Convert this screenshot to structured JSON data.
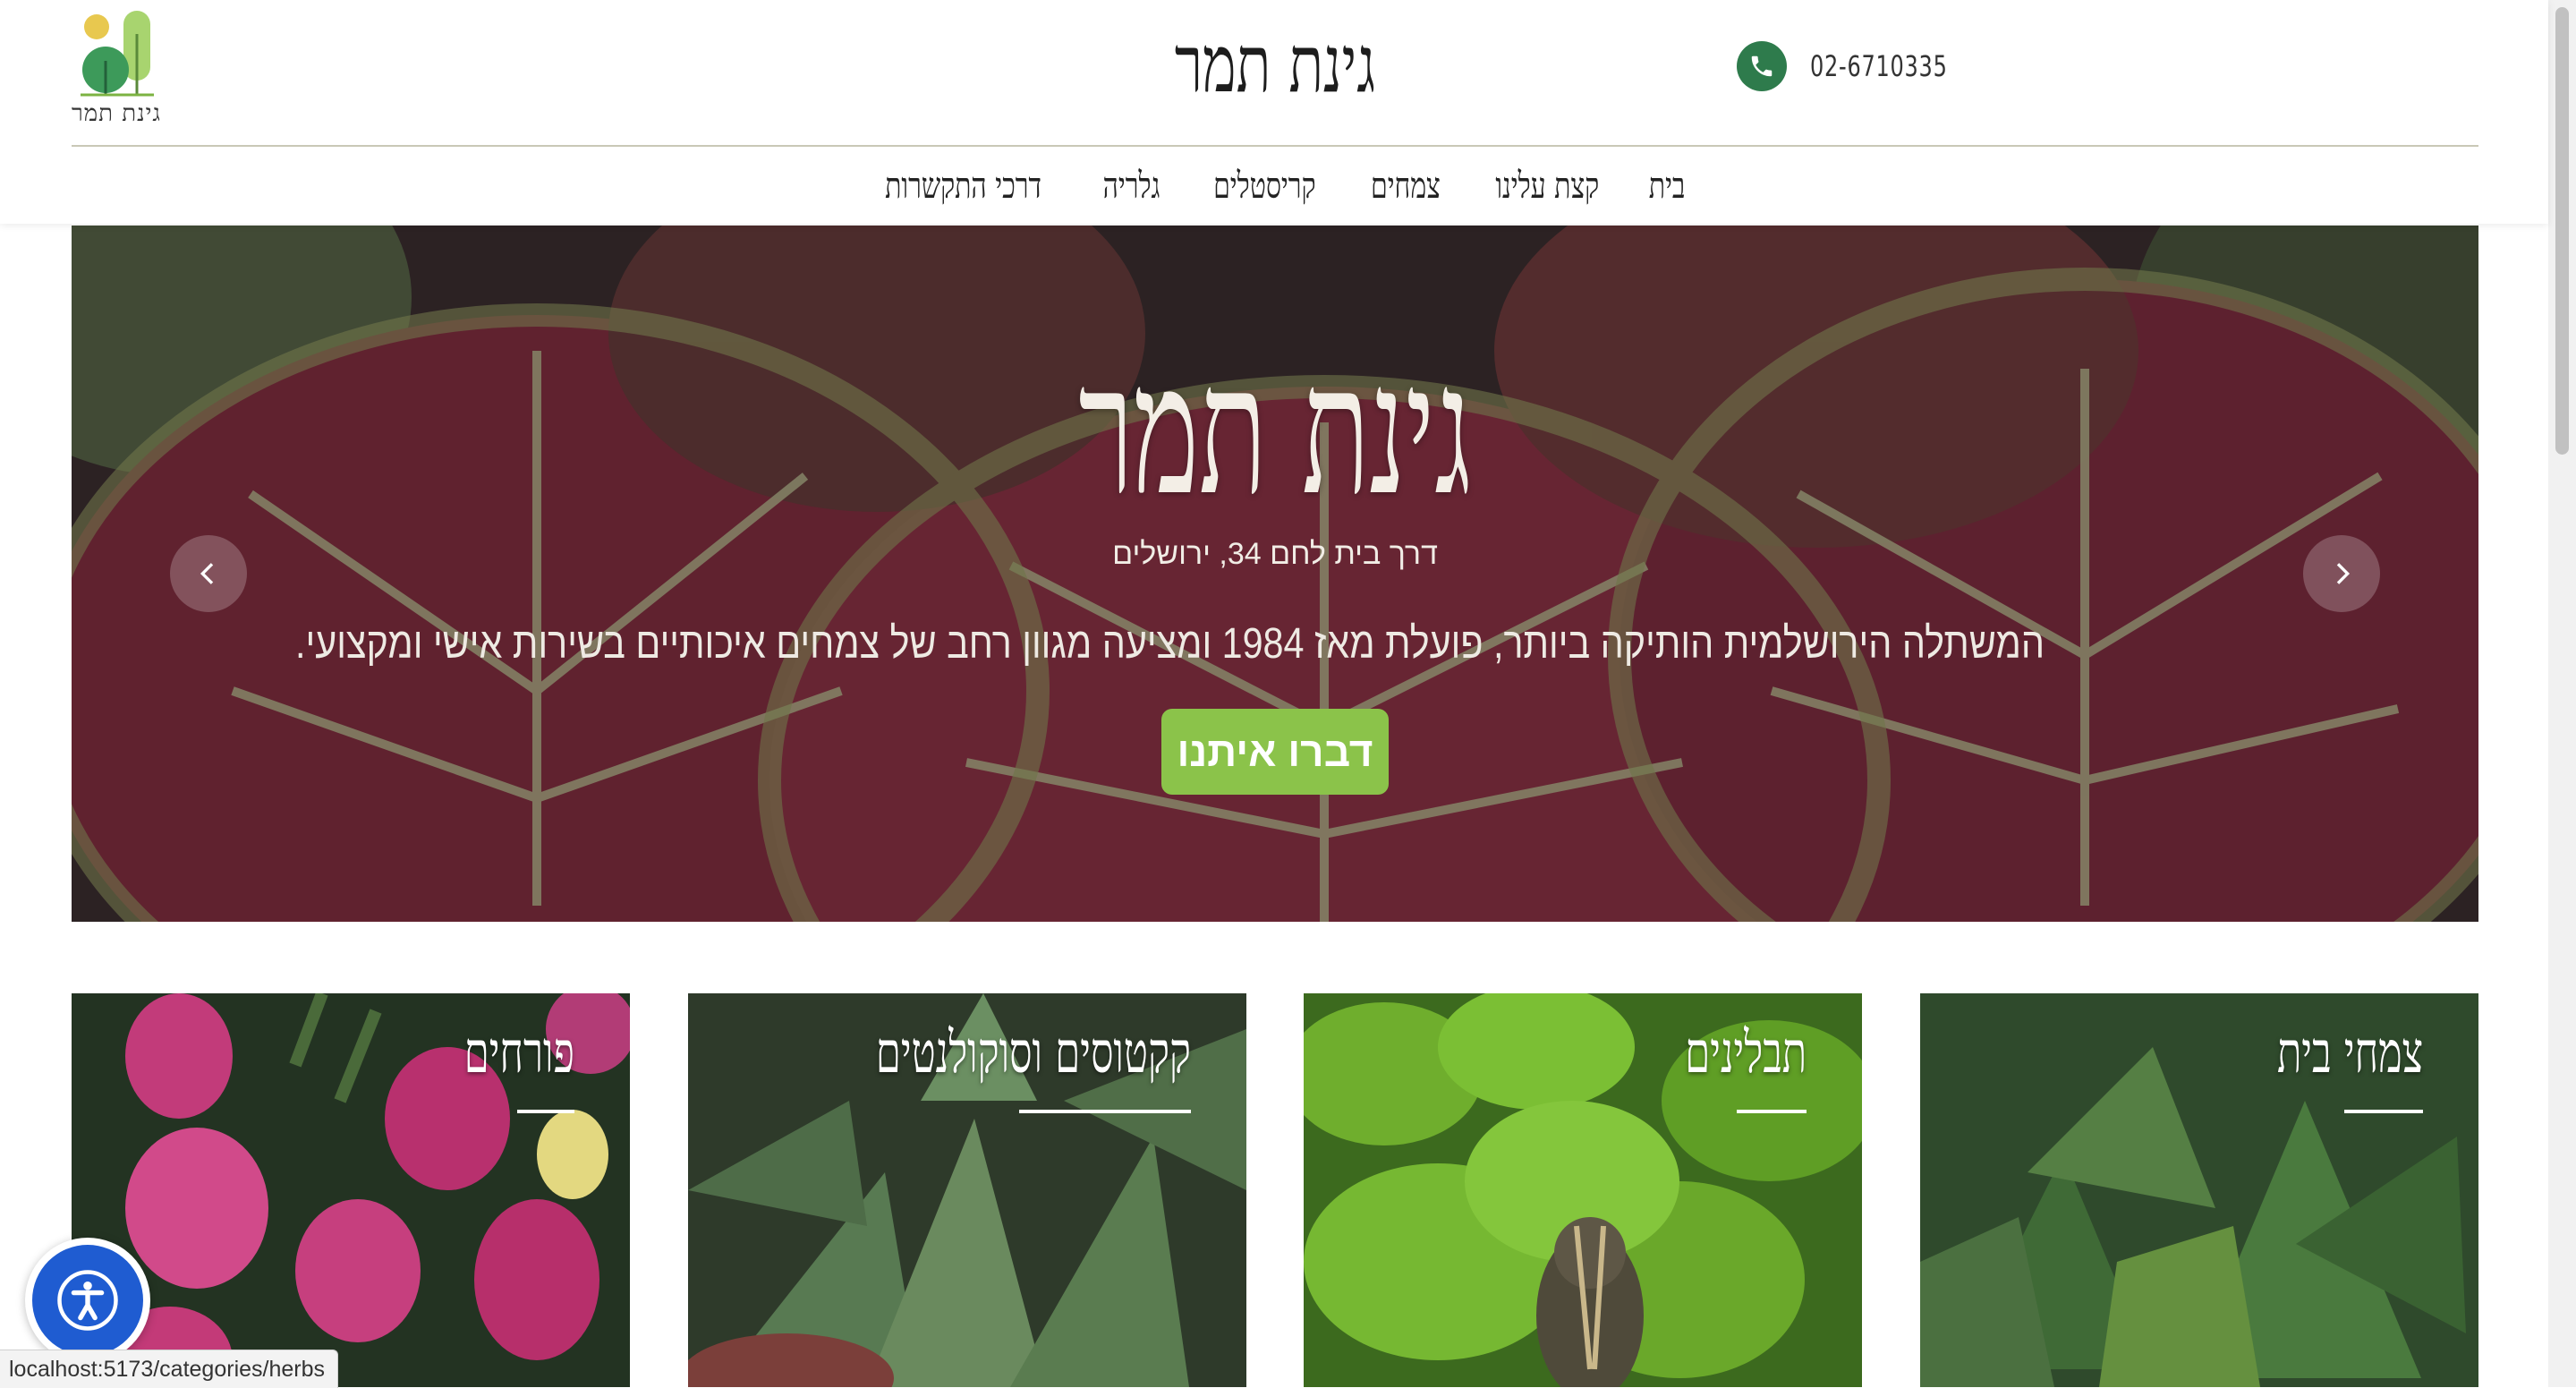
{
  "header": {
    "logo_text": "גינת תמר",
    "site_title": "גינת תמר",
    "phone": "02-6710335",
    "nav": [
      "בית",
      "קצת עלינו",
      "צמחים",
      "קריסטלים",
      "גלריה",
      "דרכי התקשרות"
    ]
  },
  "hero": {
    "title": "גינת תמר",
    "address": "דרך בית לחם 34, ירושלים",
    "description": "המשתלה הירושלמית הותיקה ביותר, פועלת מאז 1984 ומציעה מגוון רחב של צמחים איכותיים בשירות אישי ומקצועי.",
    "cta": "דברו איתנו"
  },
  "categories": [
    {
      "title": "צמחי בית"
    },
    {
      "title": "תבלינים"
    },
    {
      "title": "קקטוסים וסוקולנטים"
    },
    {
      "title": "פורחים"
    }
  ],
  "status_bar": {
    "url": "localhost:5173/categories/herbs"
  },
  "colors": {
    "accent_green": "#8bc34a",
    "phone_green": "#2e7b4c",
    "a11y_blue": "#1f5cd1"
  }
}
